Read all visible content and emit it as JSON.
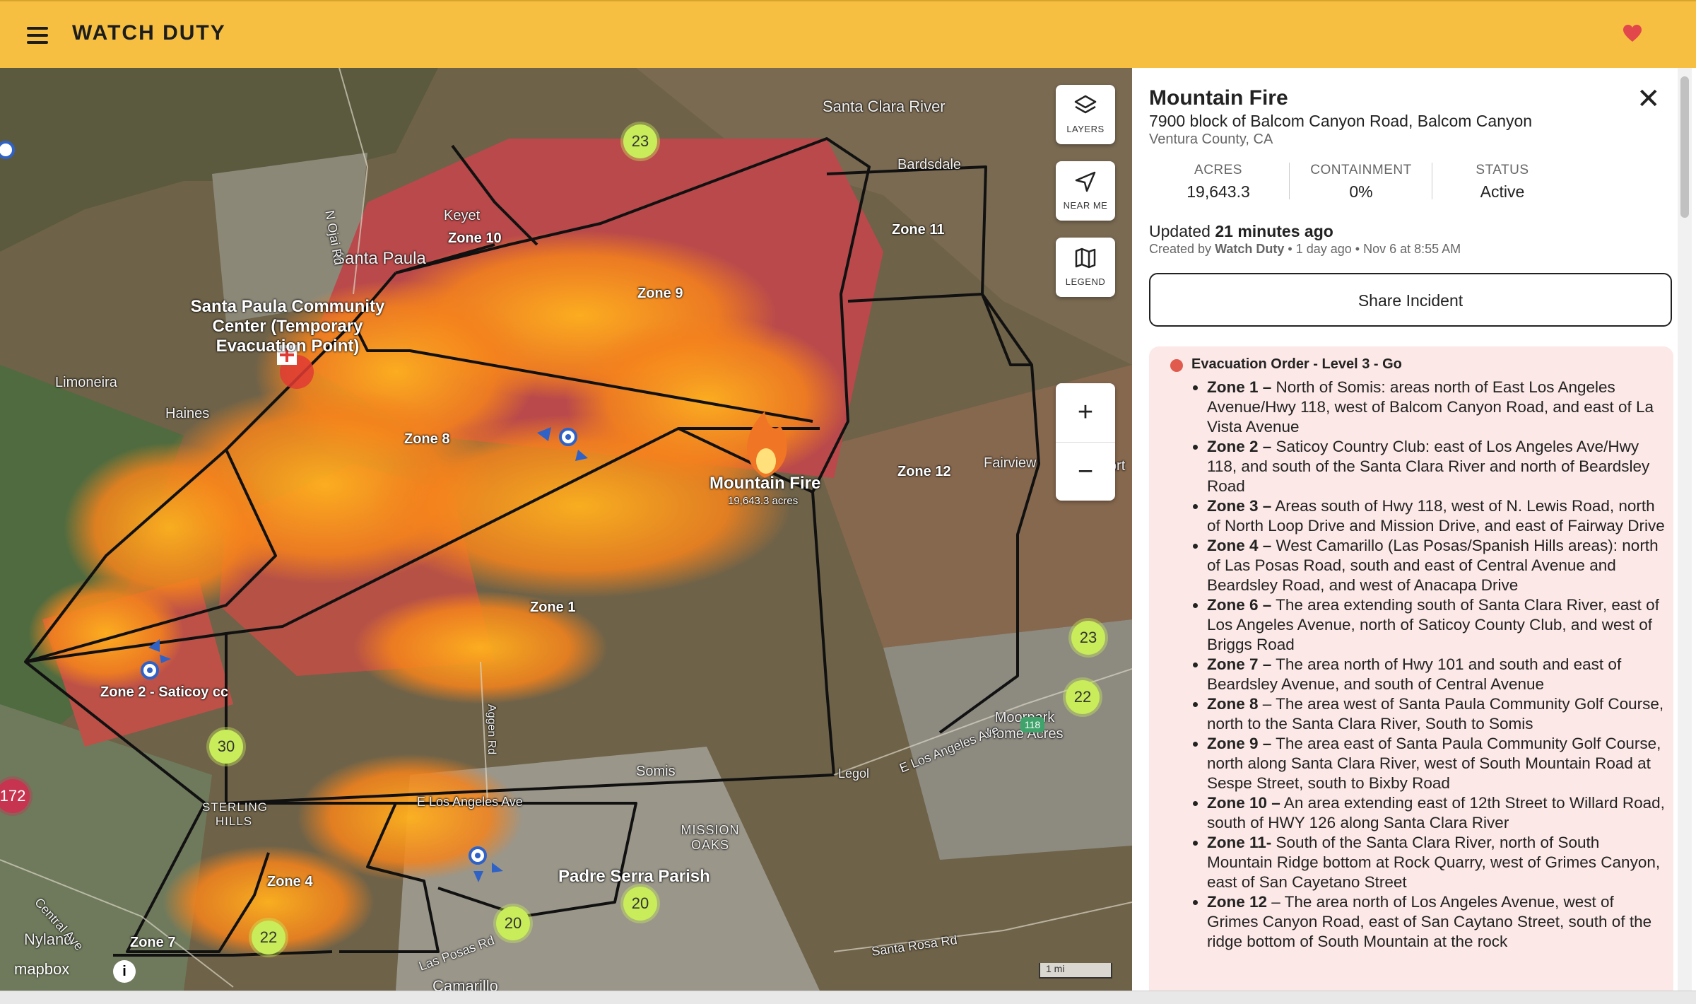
{
  "header": {
    "brand": "WATCH DUTY",
    "menu_icon": "hamburger-menu-icon",
    "favorite_icon": "heart-icon"
  },
  "map": {
    "controls": {
      "layers": "LAYERS",
      "near_me": "NEAR ME",
      "legend": "LEGEND",
      "zoom_in": "+",
      "zoom_out": "−"
    },
    "fire_marker": {
      "name": "Mountain Fire",
      "acres": "19,643.3 acres"
    },
    "zones": [
      "Zone 10",
      "Zone 9",
      "Zone 11",
      "Zone 8",
      "Zone 12",
      "Zone 1",
      "Zone 2 - Saticoy cc",
      "Zone 4",
      "Zone 7"
    ],
    "places": {
      "santa_clara_river": "Santa Clara River",
      "bardsdale": "Bardsdale",
      "keyet": "Keyet",
      "santa_paula": "Santa Paula",
      "evac_point": "Santa Paula Community Center (Temporary Evacuation Point)",
      "limoneira": "Limoneira",
      "haines": "Haines",
      "fairview": "Fairview",
      "epworth": "Epwort",
      "moorpark": "Moorpark Home Acres",
      "somis": "Somis",
      "mission_oaks": "MISSION OAKS",
      "padre_serra": "Padre Serra Parish",
      "sterling_hills": "STERLING HILLS",
      "nyland": "Nyland",
      "camarillo": "Camarillo",
      "n_ojai_rd": "N Ojai Rd",
      "aggen_rd": "Aggen Rd",
      "e_los_angeles_ave": "E Los Angeles Ave",
      "e_los_angeles_ave_2": "E Los Angeles Ave",
      "las_posas_rd": "Las Posas Rd",
      "santa_rosa_rd": "Santa Rosa Rd",
      "central_ave": "Central Ave",
      "legol": "Legol",
      "hwy_118": "118"
    },
    "clusters": [
      "23",
      "23",
      "22",
      "30",
      "172",
      "22",
      "20",
      "20"
    ],
    "attribution": "mapbox",
    "info_label": "i",
    "scale": "1 mi"
  },
  "incident": {
    "title": "Mountain Fire",
    "address": "7900 block of Balcom Canyon Road, Balcom Canyon",
    "county": "Ventura County, CA",
    "stats": [
      {
        "label": "ACRES",
        "value": "19,643.3"
      },
      {
        "label": "CONTAINMENT",
        "value": "0%"
      },
      {
        "label": "STATUS",
        "value": "Active"
      }
    ],
    "updated_prefix": "Updated ",
    "updated_value": "21 minutes ago",
    "created_prefix": "Created by ",
    "created_by": "Watch Duty",
    "created_suffix": " • 1 day ago • Nov 6 at 8:55 AM",
    "share_label": "Share Incident",
    "evacuation": {
      "heading": "Evacuation Order - Level 3 - Go",
      "status_color": "#e05a4e",
      "items": [
        {
          "zone": "Zone 1 –",
          "text": " North of Somis: areas north of East Los Angeles Avenue/Hwy 118, west of Balcom Canyon Road, and east of La Vista Avenue"
        },
        {
          "zone": "Zone 2 –",
          "text": " Saticoy Country Club: east of Los Angeles Ave/Hwy 118, and south of the Santa Clara River and north of Beardsley Road"
        },
        {
          "zone": "Zone 3 –",
          "text": " Areas south of Hwy 118, west of N. Lewis Road, north of North Loop Drive and Mission Drive, and east of Fairway Drive"
        },
        {
          "zone": "Zone 4 –",
          "text": " West Camarillo (Las Posas/Spanish Hills areas): north of Las Posas Road, south and east of Central Avenue and Beardsley Road, and west of Anacapa Drive"
        },
        {
          "zone": "Zone 6 –",
          "text": " The area extending south of Santa Clara River, east of Los Angeles Avenue, north of Saticoy County Club, and west of Briggs Road"
        },
        {
          "zone": "Zone 7 –",
          "text": " The area north of Hwy 101 and south and east of Beardsley Avenue, and south of Central Avenue"
        },
        {
          "zone": "Zone 8",
          "text": " – The area west of Santa Paula Community Golf Course, north to the Santa Clara River, South to Somis"
        },
        {
          "zone": "Zone 9 –",
          "text": " The area east of Santa Paula Community Golf Course, north along Santa Clara River, west of South Mountain Road at Sespe Street, south to Bixby Road"
        },
        {
          "zone": "Zone 10 –",
          "text": " An area extending east of 12th Street to Willard Road, south of HWY 126 along Santa Clara River"
        },
        {
          "zone": "Zone 11-",
          "text": " South of the Santa Clara River, north of South Mountain Ridge bottom at Rock Quarry, west of Grimes Canyon, east of San Cayetano Street"
        },
        {
          "zone": "Zone 12",
          "text": " – The area north of Los Angeles Avenue, west of Grimes Canyon Road, east of San Caytano Street, south of the ridge bottom of South Mountain at the rock"
        }
      ]
    }
  },
  "colors": {
    "header_bg": "#f6bf41",
    "fire_orange": "#f28a1c",
    "burn_red": "#c9454a",
    "cluster_green": "#c8ec5a"
  }
}
